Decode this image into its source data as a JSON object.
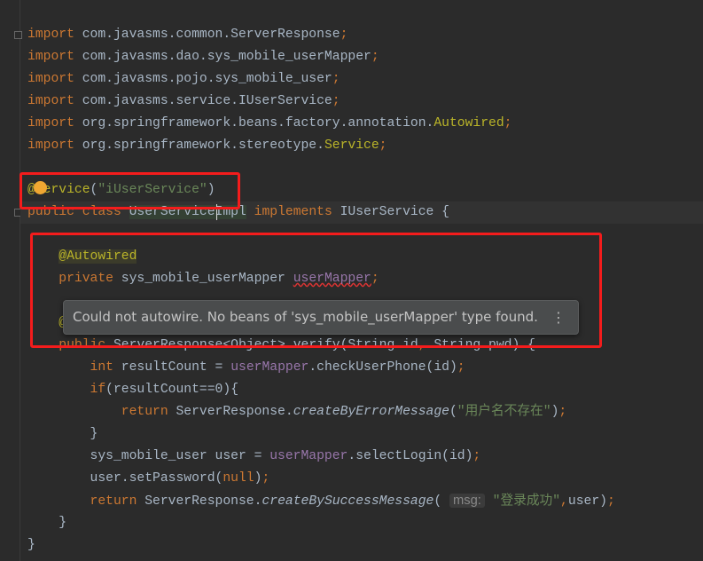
{
  "editor": {
    "lines": [
      [
        [
          "kw",
          "import"
        ],
        [
          "tx",
          " com.javasms.common.ServerResponse"
        ],
        [
          "kw",
          ";"
        ]
      ],
      [
        [
          "kw",
          "import"
        ],
        [
          "tx",
          " com.javasms.dao.sys_mobile_userMapper"
        ],
        [
          "kw",
          ";"
        ]
      ],
      [
        [
          "kw",
          "import"
        ],
        [
          "tx",
          " com.javasms.pojo.sys_mobile_user"
        ],
        [
          "kw",
          ";"
        ]
      ],
      [
        [
          "kw",
          "import"
        ],
        [
          "tx",
          " com.javasms.service.IUserService"
        ],
        [
          "kw",
          ";"
        ]
      ],
      [
        [
          "kw",
          "import"
        ],
        [
          "tx",
          " org.springframework.beans.factory.annotation."
        ],
        [
          "an",
          "Autowired"
        ],
        [
          "kw",
          ";"
        ]
      ],
      [
        [
          "kw",
          "import"
        ],
        [
          "tx",
          " org.springframework.stereotype."
        ],
        [
          "an",
          "Service"
        ],
        [
          "kw",
          ";"
        ]
      ],
      [],
      [
        [
          "an",
          "@Service"
        ],
        [
          "tx",
          "("
        ],
        [
          "st",
          "\"iUserService\""
        ],
        [
          "tx",
          ")"
        ]
      ],
      [
        [
          "kw",
          "public class "
        ],
        [
          "tx hl",
          "UserServiceImpl"
        ],
        [
          "kw",
          " implements "
        ],
        [
          "tx",
          "IUserService {"
        ]
      ],
      [],
      [
        [
          "tx",
          "    "
        ],
        [
          "an anbg",
          "@Autowired"
        ]
      ],
      [
        [
          "kw",
          "    private "
        ],
        [
          "tx",
          "sys_mobile_userMapper "
        ],
        [
          "fd err",
          "userMapper"
        ],
        [
          "kw",
          ";"
        ]
      ],
      [],
      [
        [
          "an",
          "    @Override"
        ]
      ],
      [
        [
          "kw",
          "    public "
        ],
        [
          "tx",
          "ServerResponse<Object> verify(String id"
        ],
        [
          "kw",
          ", "
        ],
        [
          "tx",
          "String pwd) {"
        ]
      ],
      [
        [
          "kw",
          "        int "
        ],
        [
          "tx",
          "resultCount = "
        ],
        [
          "fd",
          "userMapper"
        ],
        [
          "tx",
          ".checkUserPhone(id)"
        ],
        [
          "kw",
          ";"
        ]
      ],
      [
        [
          "kw",
          "        if"
        ],
        [
          "tx",
          "(resultCount=="
        ],
        [
          "tx",
          "0"
        ],
        [
          "tx",
          "){"
        ]
      ],
      [
        [
          "kw",
          "            return "
        ],
        [
          "tx",
          "ServerResponse."
        ],
        [
          "tx it",
          "createByErrorMessage"
        ],
        [
          "tx",
          "("
        ],
        [
          "st",
          "\"用户名不存在\""
        ],
        [
          "tx",
          ")"
        ],
        [
          "kw",
          ";"
        ]
      ],
      [
        [
          "tx",
          "        }"
        ]
      ],
      [
        [
          "tx",
          "        sys_mobile_user user = "
        ],
        [
          "fd",
          "userMapper"
        ],
        [
          "tx",
          ".selectLogin(id)"
        ],
        [
          "kw",
          ";"
        ]
      ],
      [
        [
          "tx",
          "        user.setPassword("
        ],
        [
          "kw",
          "null"
        ],
        [
          "tx",
          ")"
        ],
        [
          "kw",
          ";"
        ]
      ],
      [
        [
          "kw",
          "        return "
        ],
        [
          "tx",
          "ServerResponse."
        ],
        [
          "tx it",
          "createBySuccessMessage"
        ],
        [
          "tx",
          "( "
        ],
        [
          "hint",
          "msg:"
        ],
        [
          "tx",
          " "
        ],
        [
          "st",
          "\"登录成功\""
        ],
        [
          "kw",
          ","
        ],
        [
          "tx",
          "user)"
        ],
        [
          "kw",
          ";"
        ]
      ],
      [
        [
          "tx",
          "    }"
        ]
      ],
      [
        [
          "tx",
          "}"
        ]
      ]
    ]
  },
  "tooltip": {
    "message": "Could not autowire. No beans of 'sys_mobile_userMapper' type found.",
    "more_icon": "⋮"
  },
  "colors": {
    "background": "#2B2B2B",
    "keyword": "#CC7832",
    "annotation": "#BBB529",
    "string": "#6A8759",
    "field": "#9876AA",
    "highlight_box": "#F41C1C"
  }
}
